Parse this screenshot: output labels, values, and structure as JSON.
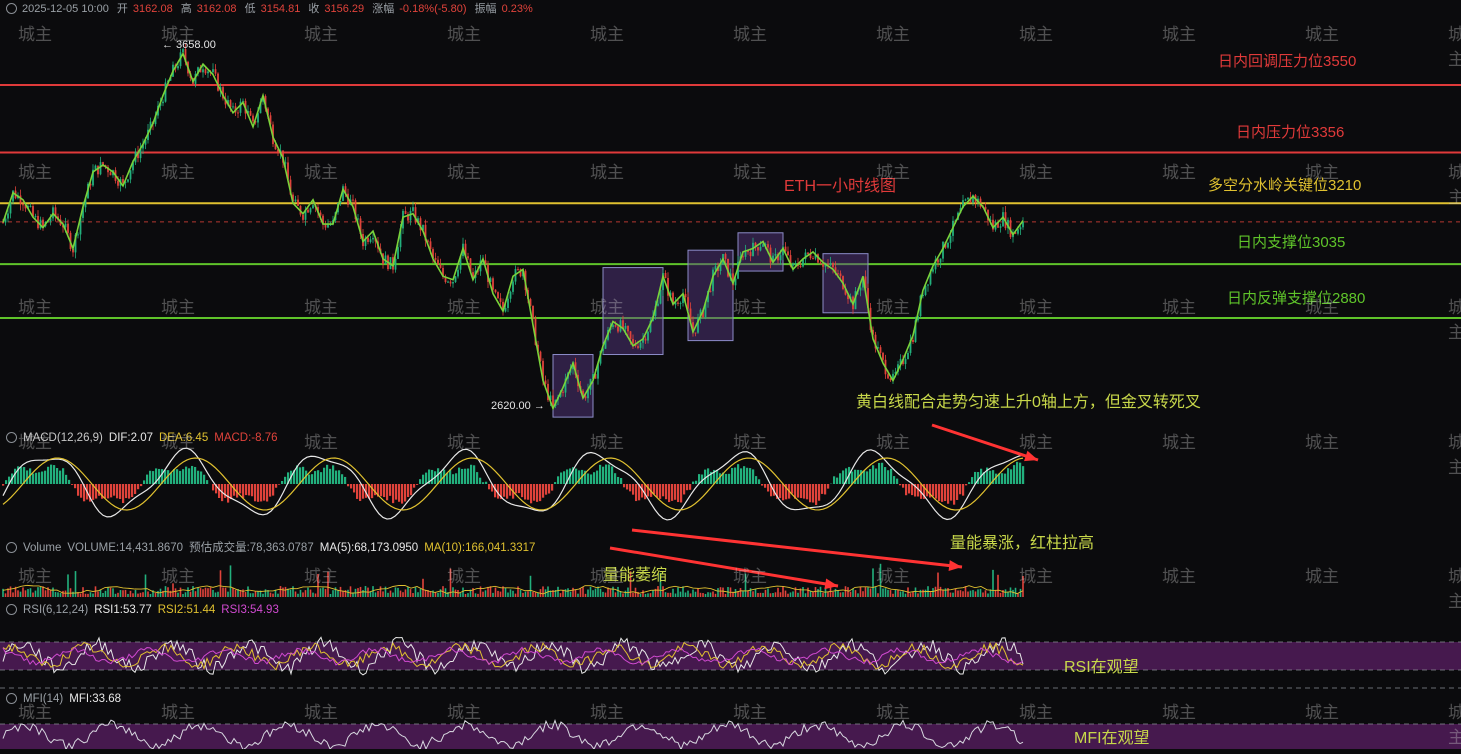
{
  "header": {
    "date": "2025-12-05 10:00",
    "open_label": "开",
    "open": "3162.08",
    "high_label": "高",
    "high": "3162.08",
    "low_label": "低",
    "low": "3154.81",
    "close_label": "收",
    "close": "3156.29",
    "change_label": "涨幅",
    "change": "-0.18%(-5.80)",
    "amplitude_label": "振幅",
    "amplitude": "0.23%"
  },
  "chart_data": {
    "type": "line",
    "title": "ETH一小时线图",
    "ylim": [
      2560,
      3720
    ],
    "extremes": {
      "high": "← 3658.00",
      "low": "2620.00 →"
    },
    "levels": [
      {
        "label": "日内回调压力位3550",
        "value": 3550,
        "color": "#e03a3a"
      },
      {
        "label": "日内压力位3356",
        "value": 3356,
        "color": "#e03a3a"
      },
      {
        "label": "多空分水岭关键位3210",
        "value": 3210,
        "color": "#e0c130"
      },
      {
        "label": "日内支撑位3035",
        "value": 3035,
        "color": "#5fc42a"
      },
      {
        "label": "日内反弹支撑位2880",
        "value": 2880,
        "color": "#5fc42a"
      }
    ],
    "price_x": [
      0,
      10,
      20,
      30,
      40,
      50,
      60,
      70,
      80,
      90,
      100,
      110,
      120,
      130,
      140,
      150,
      160,
      170,
      180,
      190,
      200,
      210,
      220,
      230,
      240,
      250,
      260,
      270,
      280,
      290,
      300,
      310,
      320,
      330,
      340,
      350,
      360,
      370,
      380,
      390,
      400,
      410,
      420,
      430,
      440,
      450,
      460,
      470,
      480,
      490,
      500,
      510,
      520,
      530,
      540,
      550,
      560,
      570,
      580,
      590,
      600,
      610,
      620,
      630,
      640,
      650,
      660,
      670,
      680,
      690,
      700,
      710,
      720,
      730,
      740,
      750,
      760,
      770,
      780,
      790,
      800,
      810,
      820,
      830,
      840,
      850,
      860,
      870,
      880,
      890,
      900,
      910,
      920,
      930,
      940,
      950,
      960,
      970,
      980,
      990,
      1000,
      1010,
      1020
    ],
    "price_y": [
      3155,
      3240,
      3220,
      3170,
      3140,
      3180,
      3150,
      3080,
      3200,
      3300,
      3320,
      3300,
      3260,
      3330,
      3380,
      3440,
      3520,
      3590,
      3640,
      3560,
      3610,
      3580,
      3520,
      3470,
      3500,
      3430,
      3520,
      3400,
      3340,
      3210,
      3180,
      3220,
      3150,
      3150,
      3250,
      3200,
      3100,
      3130,
      3050,
      3030,
      3170,
      3180,
      3130,
      3050,
      3000,
      2990,
      3080,
      2990,
      3050,
      2950,
      2900,
      3000,
      3020,
      2860,
      2700,
      2620,
      2680,
      2750,
      2650,
      2700,
      2800,
      2870,
      2850,
      2800,
      2820,
      2880,
      3000,
      2920,
      2950,
      2840,
      2900,
      3000,
      3050,
      2980,
      3070,
      3080,
      3100,
      3040,
      3080,
      3020,
      3050,
      3070,
      3040,
      3020,
      2980,
      2920,
      3000,
      2820,
      2750,
      2700,
      2760,
      2830,
      2960,
      3030,
      3080,
      3140,
      3200,
      3230,
      3200,
      3140,
      3170,
      3120,
      3160
    ],
    "consolidation_boxes": [
      [
        550,
        590
      ],
      [
        600,
        660
      ],
      [
        685,
        730
      ],
      [
        735,
        780
      ],
      [
        820,
        865
      ]
    ],
    "macd": {
      "label": "MACD(12,26,9)",
      "dif": "DIF:2.07",
      "dea": "DEA:6.45",
      "hist": "MACD:-8.76"
    },
    "volume": {
      "label": "Volume",
      "vol": "VOLUME:14,431.8670",
      "est": "预估成交量:78,363.0787",
      "ma5": "MA(5):68,173.0950",
      "ma10": "MA(10):166,041.3317"
    },
    "rsi": {
      "label": "RSI(6,12,24)",
      "rsi1": "RSI1:53.77",
      "rsi2": "RSI2:51.44",
      "rsi3": "RSI3:54.93"
    },
    "mfi": {
      "label": "MFI(14)",
      "mfi": "MFI:33.68"
    }
  },
  "annotations": {
    "macd_note": "黄白线配合走势匀速上升0轴上方，但金叉转死叉",
    "volume_up": "量能暴涨，红柱拉高",
    "volume_down": "量能萎缩",
    "rsi_note": "RSI在观望",
    "mfi_note": "MFI在观望"
  },
  "watermark": "城主",
  "colors": {
    "up": "#22b07d",
    "down": "#e0433b",
    "dif": "#e8e8e8",
    "dea": "#e0c130",
    "band": "#4a1a52"
  }
}
